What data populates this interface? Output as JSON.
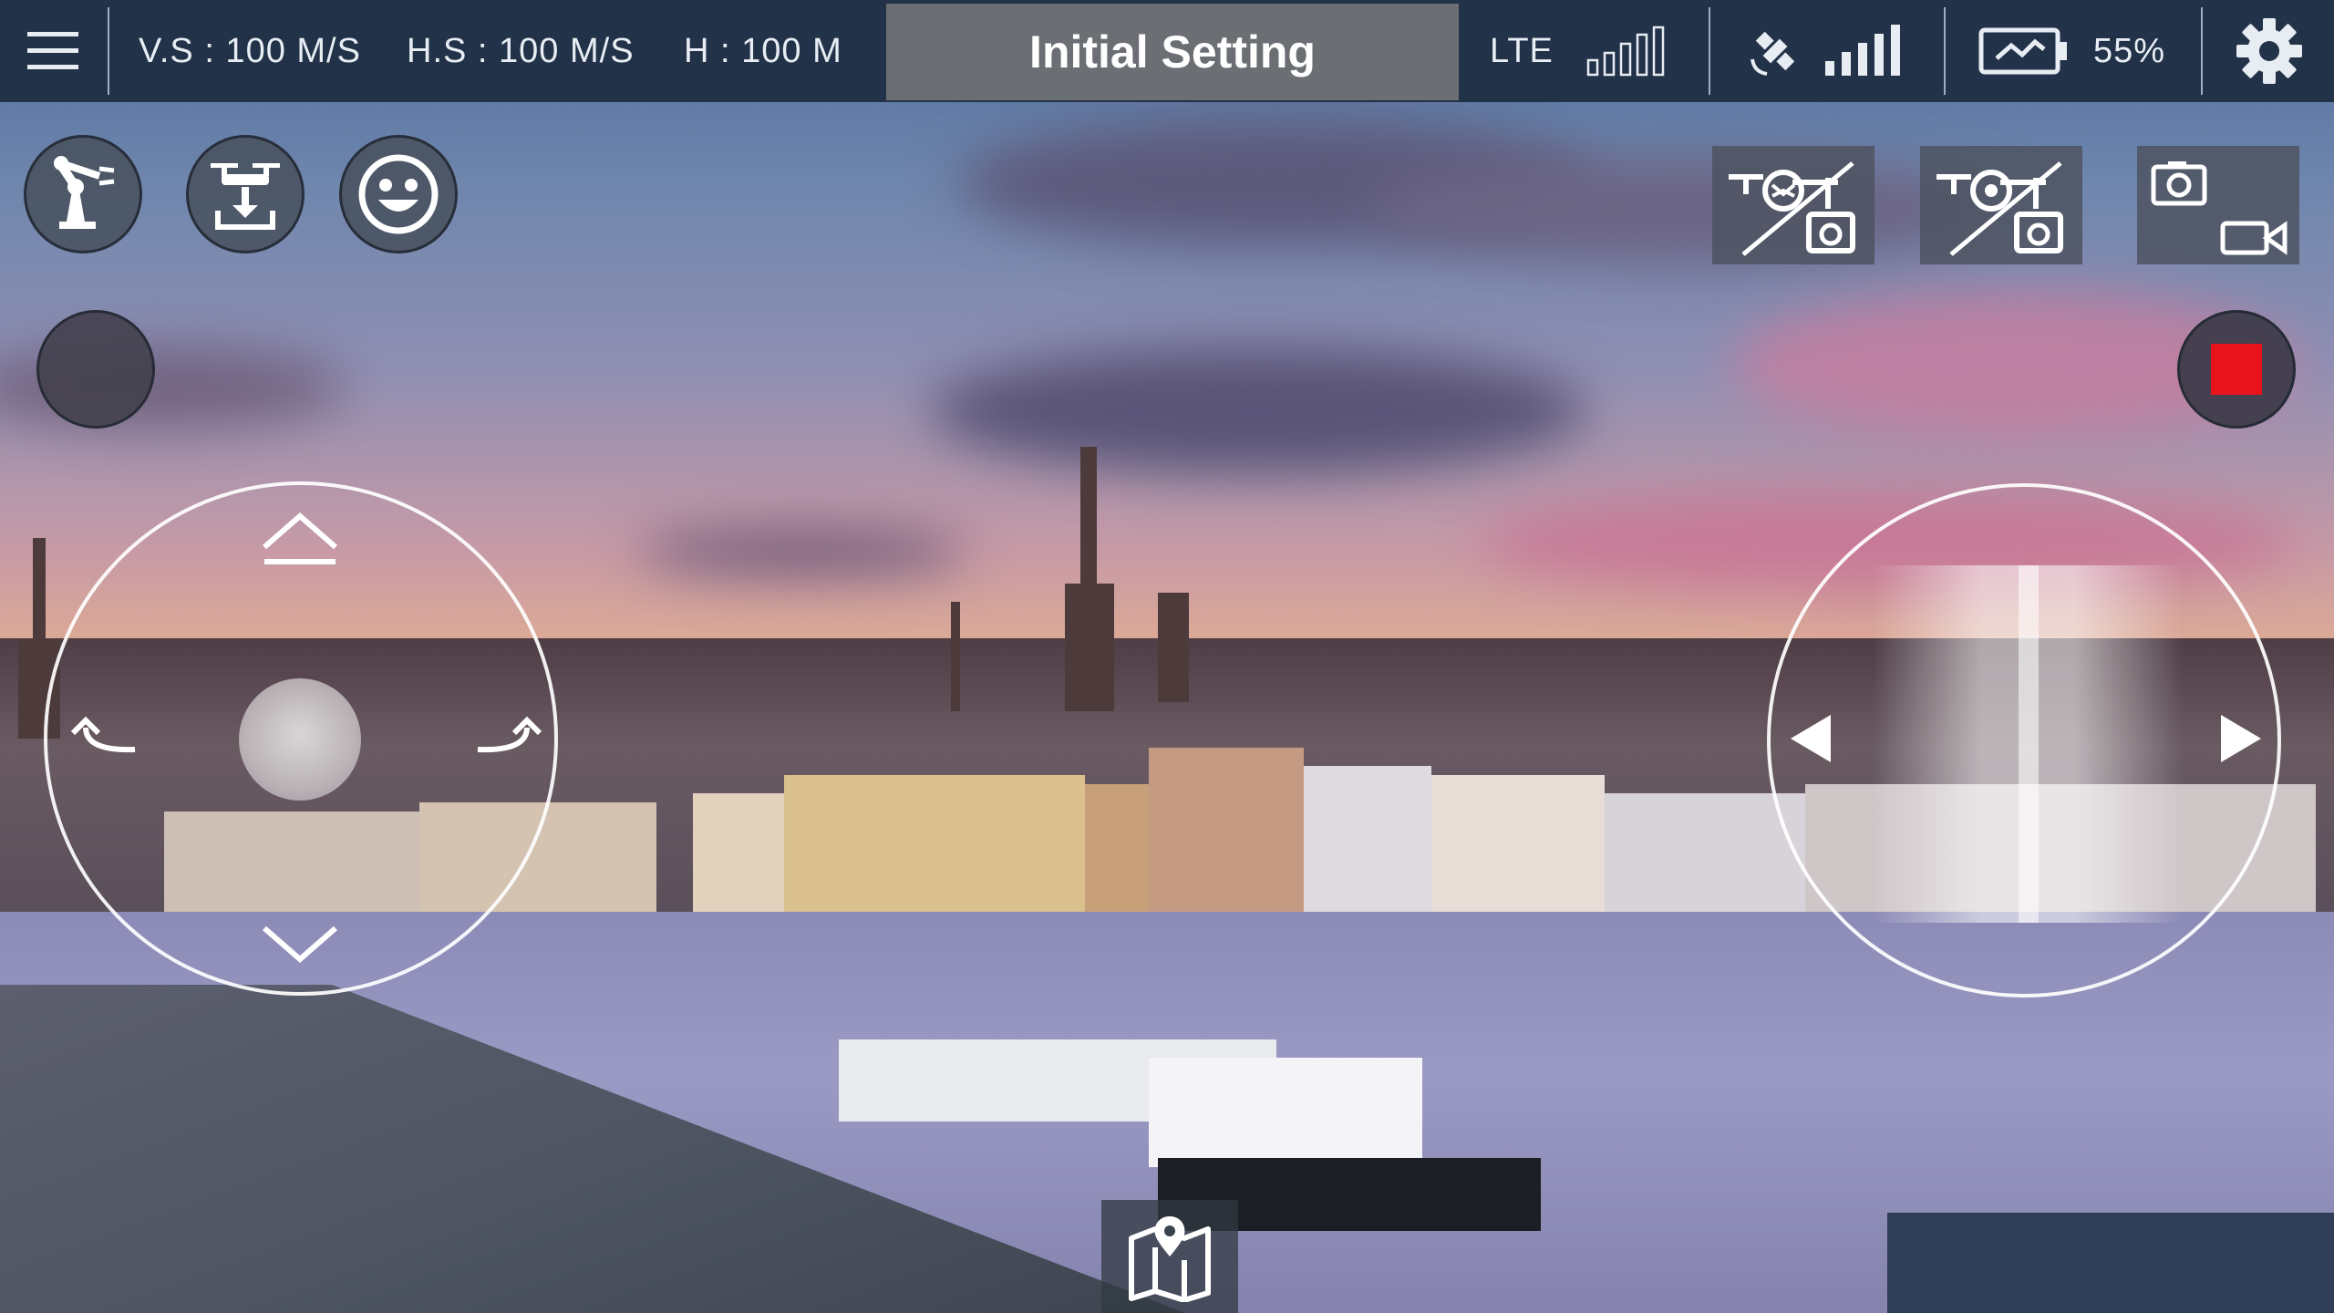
{
  "status_bar": {
    "menu_icon": "hamburger-menu-icon",
    "vertical_speed": "V.S : 100 M/S",
    "horizontal_speed": "H.S : 100 M/S",
    "height": "H : 100 M",
    "title": "Initial Setting",
    "network_label": "LTE",
    "gps_icon": "satellite-icon",
    "battery_percent": "55%",
    "battery_level": 0.55,
    "settings_icon": "gear-icon"
  },
  "left_controls": {
    "arm_icon": "robot-arm-icon",
    "land_icon": "drone-land-icon",
    "face_icon": "smiley-face-icon",
    "toggle_icon": "blank-round-button"
  },
  "right_controls": {
    "gimbal_off_icon": "drone-camera-disabled-icon",
    "camera_off_icon": "drone-camera-disabled-icon",
    "capture_icon": "photo-video-icon",
    "record_icon": "record-stop-icon",
    "record_color": "#e8141c"
  },
  "joysticks": {
    "left": {
      "up_icon": "chevron-up-icon",
      "down_icon": "chevron-down-icon",
      "rotate_left_icon": "rotate-left-icon",
      "rotate_right_icon": "rotate-right-icon"
    },
    "right": {
      "left_icon": "triangle-left-icon",
      "right_icon": "triangle-right-icon"
    }
  },
  "bottom": {
    "map_icon": "map-pin-icon"
  },
  "colors": {
    "bar": "#223248",
    "title_box": "#6b6e72",
    "text": "#e8edf4"
  }
}
